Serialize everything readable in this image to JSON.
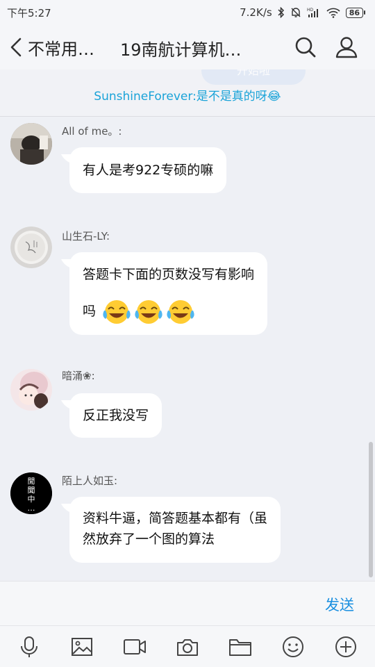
{
  "status_bar": {
    "time": "下午5:27",
    "network_speed": "7.2K/s",
    "icons": [
      "bluetooth-icon",
      "mute-icon",
      "hd-signal-icon",
      "wifi-icon",
      "battery-icon"
    ],
    "battery_level": "86"
  },
  "header": {
    "back_label": "不常用…",
    "title": "19南航计算机…",
    "icons": [
      "search-icon",
      "group-members-icon"
    ]
  },
  "notice": {
    "ghost_text": "开始啦",
    "text": "SunshineForever:是不是真的呀😂"
  },
  "messages": [
    {
      "sender": "All of me。:",
      "text": "有人是考922专硕的嘛"
    },
    {
      "sender": "山生石-LY:",
      "text_line1": "答题卡下面的页数没写有影响",
      "text_line2": "吗",
      "emoji_count": 3
    },
    {
      "sender": "暗涌❀:",
      "text": "反正我没写"
    },
    {
      "sender": "陌上人如玉:",
      "text_line1": "资料牛逼，简答题基本都有（虽",
      "text_line2": "然放弃了一个图的算法",
      "avatar_text": "閒 聞 中 …"
    }
  ],
  "input": {
    "send_label": "发送"
  },
  "toolbar": {
    "items": [
      "voice-icon",
      "image-icon",
      "video-icon",
      "camera-icon",
      "folder-icon",
      "emoji-icon",
      "plus-icon"
    ]
  },
  "colors": {
    "accent": "#1a8fe0",
    "notice_text": "#1aa3d8",
    "background": "#eef0f5",
    "bubble": "#ffffff"
  }
}
